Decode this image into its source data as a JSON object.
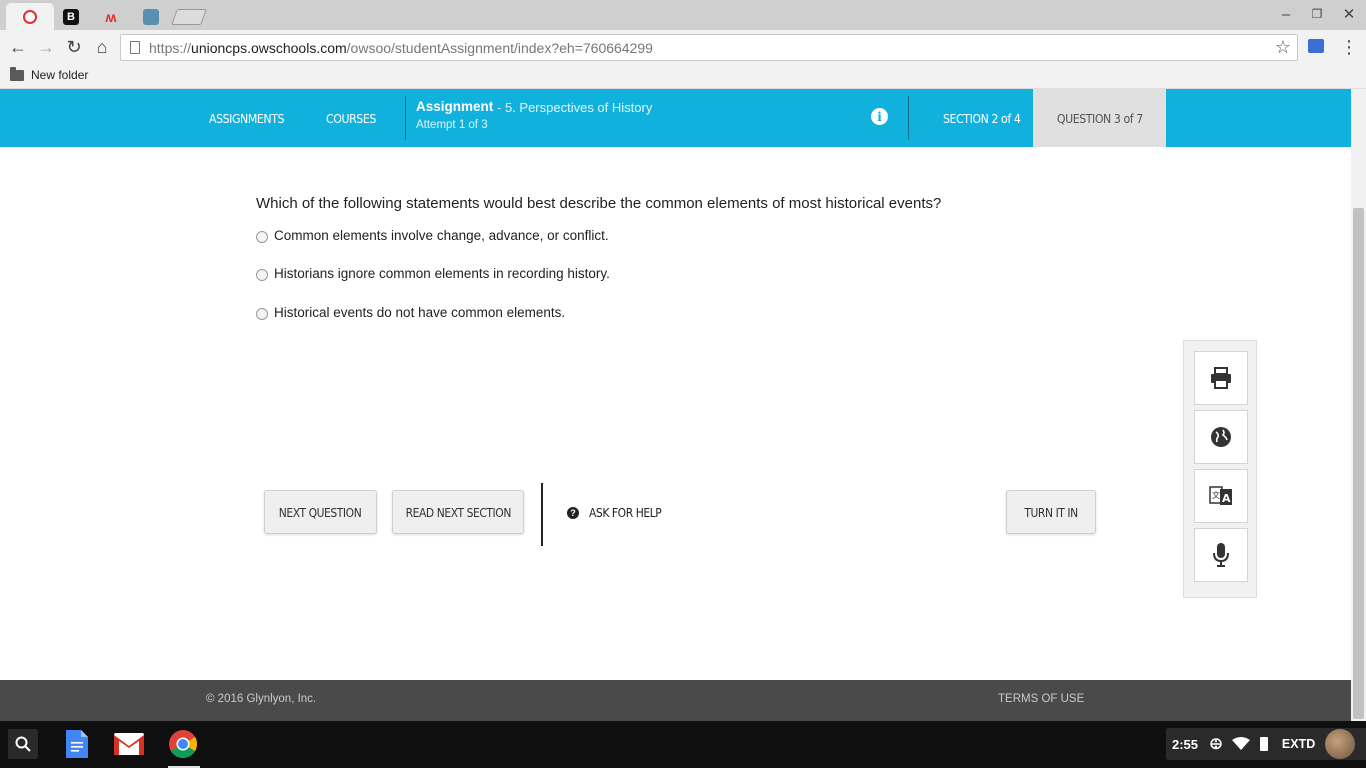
{
  "browser": {
    "url_prefix": "https://",
    "url_host": "unioncps.owschools.com",
    "url_path": "/owsoo/studentAssignment/index?eh=760664299",
    "bookmark_folder": "New folder"
  },
  "header": {
    "nav_assignments": "ASSIGNMENTS",
    "nav_courses": "COURSES",
    "assignment_label": "Assignment",
    "assignment_name": "- 5. Perspectives of History",
    "attempt": "Attempt 1 of 3",
    "section": "SECTION 2 of 4",
    "question": "QUESTION 3 of 7"
  },
  "question": {
    "prompt": "Which of the following statements would best describe the common elements of most historical events?",
    "options": [
      "Common elements involve change, advance, or conflict.",
      "Historians ignore common elements in recording history.",
      "Historical events do not have common elements."
    ]
  },
  "actions": {
    "next_question": "NEXT QUESTION",
    "read_next_section": "READ NEXT SECTION",
    "ask_for_help": "ASK FOR HELP",
    "turn_it_in": "TURN IT IN"
  },
  "tools": [
    "printer-icon",
    "globe-icon",
    "translate-icon",
    "microphone-icon"
  ],
  "footer": {
    "copyright": "© 2016 Glynlyon, Inc.",
    "terms": "TERMS OF USE"
  },
  "tray": {
    "time": "2:55",
    "input_method": "EXTD"
  },
  "colors": {
    "header_blue": "#10b2dd",
    "footer_gray": "#4a4a4a"
  }
}
